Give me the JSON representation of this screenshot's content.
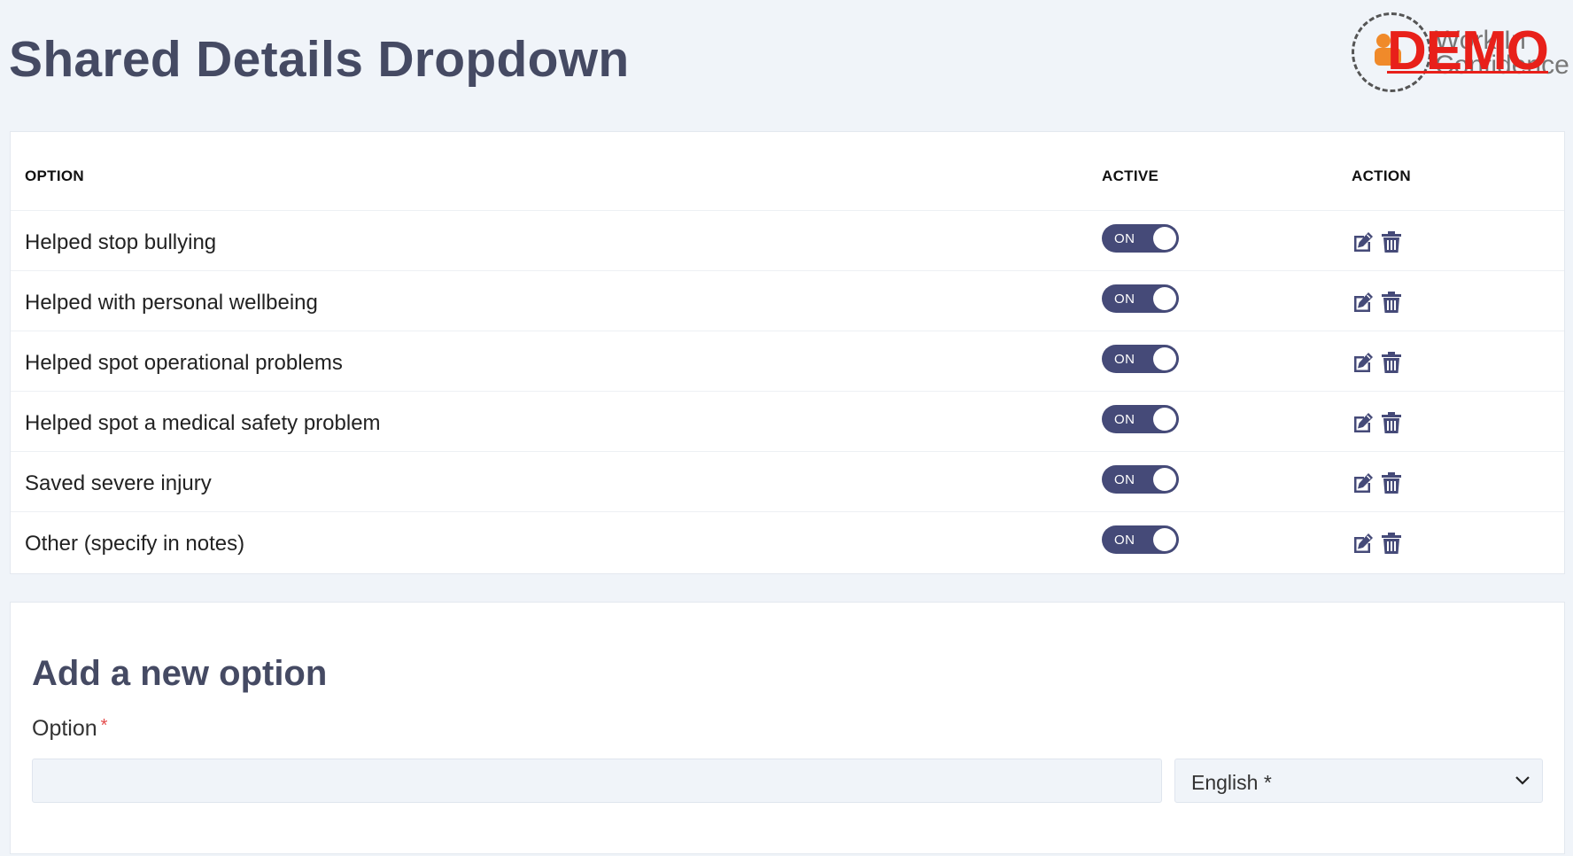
{
  "page": {
    "title": "Shared Details Dropdown"
  },
  "logo": {
    "brand_lines": [
      "Work In",
      "Confidence"
    ],
    "watermark": "DEMO"
  },
  "table": {
    "headers": {
      "option": "OPTION",
      "active": "ACTIVE",
      "action": "ACTION"
    },
    "rows": [
      {
        "option": "Helped stop bullying",
        "active_label": "ON"
      },
      {
        "option": "Helped with personal wellbeing",
        "active_label": "ON"
      },
      {
        "option": "Helped spot operational problems",
        "active_label": "ON"
      },
      {
        "option": "Helped spot a medical safety problem",
        "active_label": "ON"
      },
      {
        "option": "Saved severe injury",
        "active_label": "ON"
      },
      {
        "option": "Other (specify in notes)",
        "active_label": "ON"
      }
    ]
  },
  "form": {
    "title": "Add a new option",
    "option_label": "Option",
    "required_marker": "*",
    "option_value": "",
    "language_selected": "English *"
  },
  "colors": {
    "title": "#454a63",
    "toggle_on": "#454a78",
    "icon": "#454a78",
    "required": "#e34b4b",
    "watermark": "#e8201a",
    "background": "#f0f4f9"
  },
  "icons": {
    "edit": "edit-icon",
    "delete": "trash-icon",
    "select": "chevron-down-icon"
  }
}
